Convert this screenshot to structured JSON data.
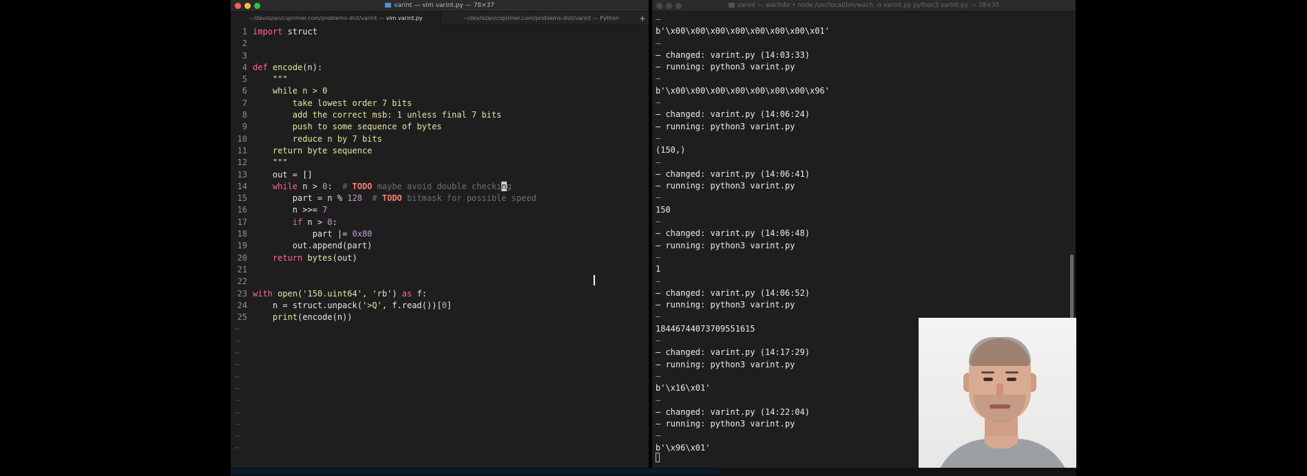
{
  "vim": {
    "title": "varint — vim varint.py — 78×37",
    "tabs": [
      {
        "path": "~/dev/ozan/csprimer.com/problems-dist/varint — ",
        "bold": "vim varint.py"
      },
      {
        "path": "~/dev/ozan/csprimer.com/problems-dist/varint — ",
        "bold": "Python"
      }
    ],
    "add_tab": "+",
    "code_lines": [
      {
        "n": "1",
        "html": "<span class=\"kw\">import</span> struct"
      },
      {
        "n": "2",
        "html": ""
      },
      {
        "n": "3",
        "html": ""
      },
      {
        "n": "4",
        "html": "<span class=\"kw\">def</span> <span class=\"fn\">encode</span>(n):"
      },
      {
        "n": "5",
        "html": "    <span class=\"str\">\"\"\"</span>"
      },
      {
        "n": "6",
        "html": "<span class=\"str\">    while n &gt; 0</span>"
      },
      {
        "n": "7",
        "html": "<span class=\"str\">        take lowest order 7 bits</span>"
      },
      {
        "n": "8",
        "html": "<span class=\"str\">        add the correct msb: 1 unless final 7 bits</span>"
      },
      {
        "n": "9",
        "html": "<span class=\"str\">        push to some sequence of bytes</span>"
      },
      {
        "n": "10",
        "html": "<span class=\"str\">        reduce n by 7 bits</span>"
      },
      {
        "n": "11",
        "html": "<span class=\"str\">    return byte sequence</span>"
      },
      {
        "n": "12",
        "html": "<span class=\"str\">    \"\"\"</span>"
      },
      {
        "n": "13",
        "html": "    out = []"
      },
      {
        "n": "14",
        "html": "    <span class=\"kw\">while</span> n &gt; <span class=\"num\">0</span>:  <span class=\"cm\"># <span class=\"todo\">TODO</span> maybe avoid double checki</span><span class=\"cursor-block\">n</span><span class=\"cm\">g</span>"
      },
      {
        "n": "15",
        "html": "        part = n % <span class=\"num\">128</span>  <span class=\"cm\"># <span class=\"todo\">TODO</span> bitmask for possible speed</span>"
      },
      {
        "n": "16",
        "html": "        n &gt;&gt;= <span class=\"num\">7</span>"
      },
      {
        "n": "17",
        "html": "        <span class=\"kw\">if</span> n &gt; <span class=\"num\">0</span>:"
      },
      {
        "n": "18",
        "html": "            part |= <span class=\"num\">0x80</span>"
      },
      {
        "n": "19",
        "html": "        out.append(part)"
      },
      {
        "n": "20",
        "html": "    <span class=\"kw\">return</span> <span class=\"fn\">bytes</span>(out)"
      },
      {
        "n": "21",
        "html": ""
      },
      {
        "n": "22",
        "html": ""
      },
      {
        "n": "23",
        "html": "<span class=\"kw\">with</span> <span class=\"fn\">open</span>(<span class=\"str\">'150.uint64'</span>, <span class=\"str\">'rb'</span>) <span class=\"kw\">as</span> f:"
      },
      {
        "n": "24",
        "html": "    n = struct.unpack(<span class=\"str\">'&gt;Q'</span>, f.read())[<span class=\"num\">0</span>]"
      },
      {
        "n": "25",
        "html": "    <span class=\"fn\">print</span>(encode(n))"
      }
    ],
    "tilde": "~",
    "tilde_count": 11
  },
  "terminal": {
    "title": "varint — wachdir • node /usr/local/bin/wach -o varint.py python3 varint.py — 78×35",
    "lines": [
      "–",
      "b'\\x00\\x00\\x00\\x00\\x00\\x00\\x00\\x01'",
      "–",
      "– changed: varint.py (14:03:33)",
      "– running: python3 varint.py",
      "–",
      "b'\\x00\\x00\\x00\\x00\\x00\\x00\\x00\\x96'",
      "–",
      "– changed: varint.py (14:06:24)",
      "– running: python3 varint.py",
      "–",
      "(150,)",
      "–",
      "– changed: varint.py (14:06:41)",
      "– running: python3 varint.py",
      "–",
      "150",
      "–",
      "– changed: varint.py (14:06:48)",
      "– running: python3 varint.py",
      "–",
      "1",
      "–",
      "– changed: varint.py (14:06:52)",
      "– running: python3 varint.py",
      "–",
      "18446744073709551615",
      "–",
      "– changed: varint.py (14:17:29)",
      "– running: python3 varint.py",
      "–",
      "b'\\x16\\x01'",
      "–",
      "– changed: varint.py (14:22:04)",
      "– running: python3 varint.py",
      "–",
      "b'\\x96\\x01'"
    ]
  },
  "colors": {
    "background": "#1e1e1e",
    "keyword": "#ff6a86",
    "string": "#e6e6a0",
    "number": "#c49bd8",
    "comment": "#6e6e6e",
    "todo": "#ff7f6a"
  }
}
